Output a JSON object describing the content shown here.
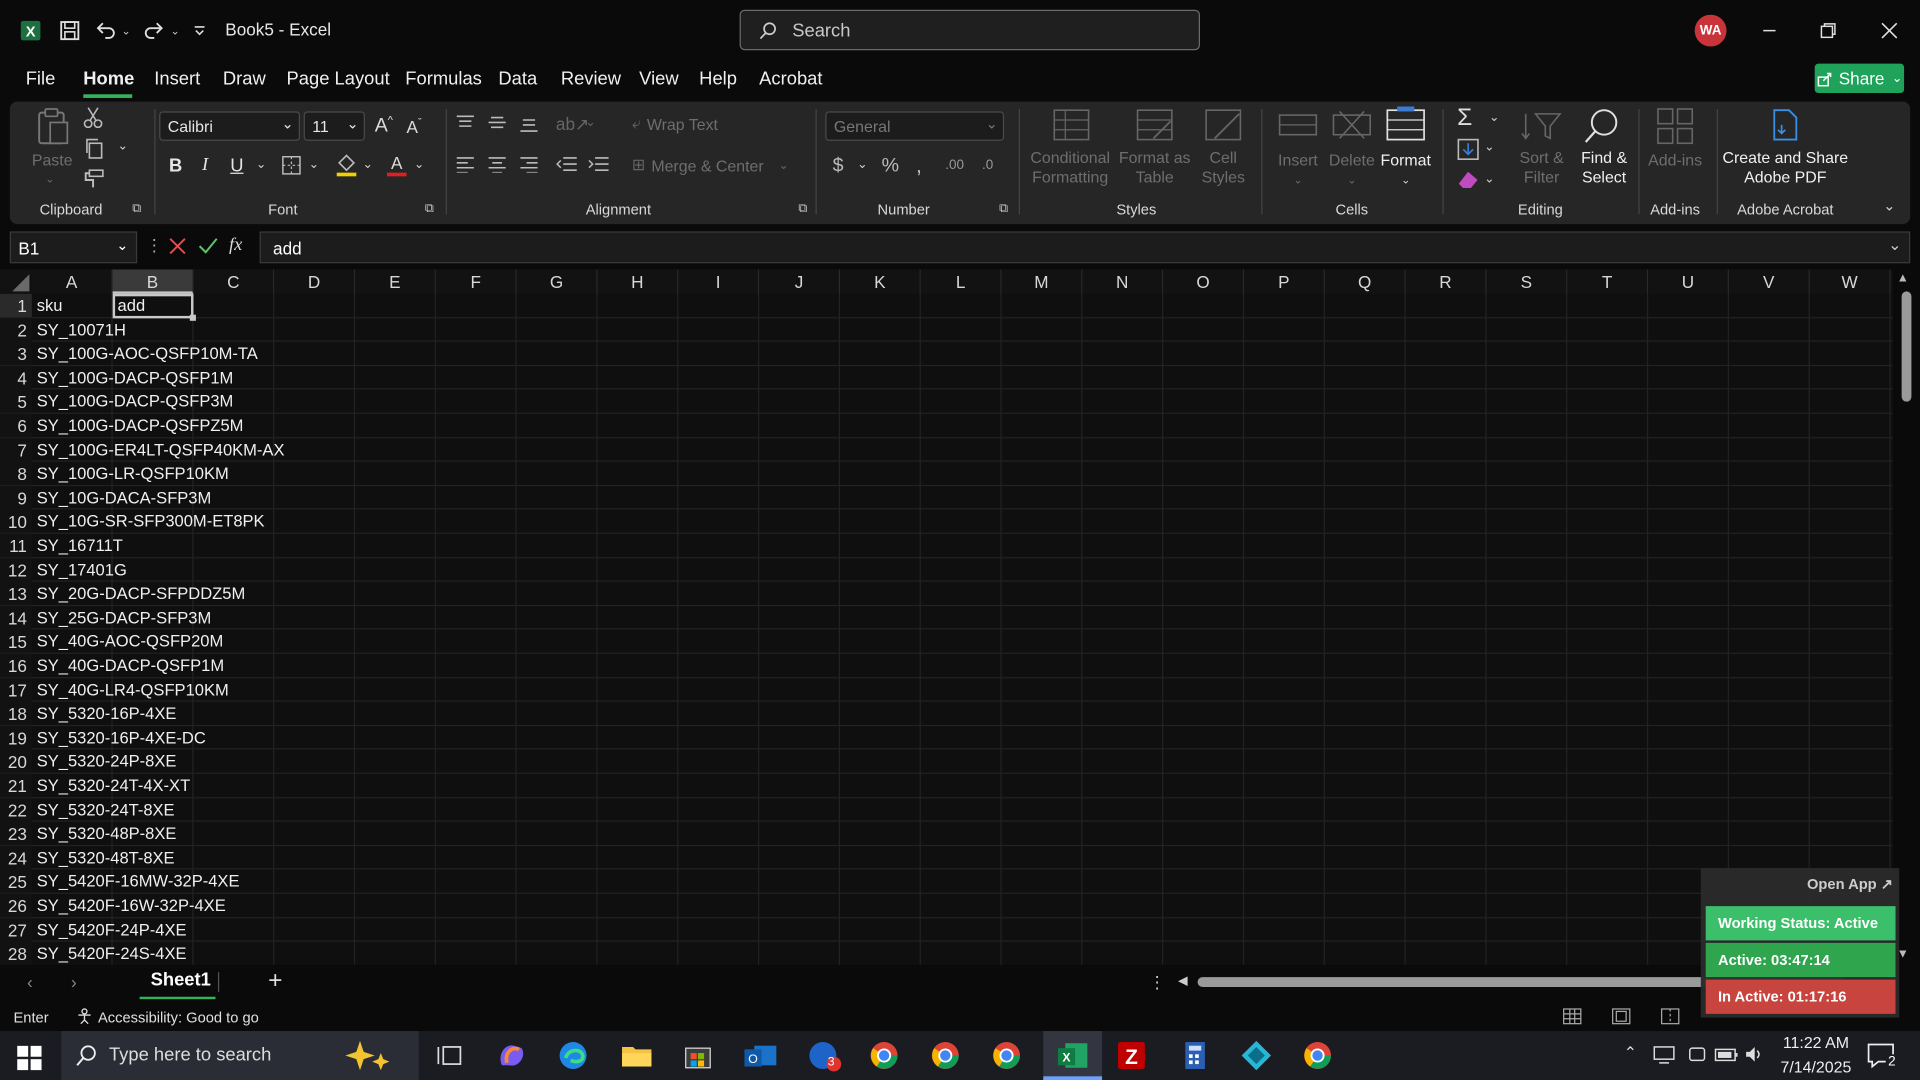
{
  "titlebar": {
    "title": "Book5  -  Excel",
    "search_placeholder": "Search",
    "avatar_initials": "WA"
  },
  "menu": [
    "File",
    "Home",
    "Insert",
    "Draw",
    "Page Layout",
    "Formulas",
    "Data",
    "Review",
    "View",
    "Help",
    "Acrobat"
  ],
  "share_label": "Share",
  "ribbon": {
    "font_name": "Calibri",
    "font_size": "11",
    "wrap_text": "Wrap Text",
    "merge_center": "Merge & Center",
    "number_format": "General",
    "paste": "Paste",
    "conditional_formatting": [
      "Conditional",
      "Formatting"
    ],
    "format_as_table": [
      "Format as",
      "Table"
    ],
    "cell_styles": [
      "Cell",
      "Styles"
    ],
    "insert": "Insert",
    "delete": "Delete",
    "format": "Format",
    "sort_filter": [
      "Sort &",
      "Filter"
    ],
    "find_select": [
      "Find &",
      "Select"
    ],
    "add_ins": "Add-ins",
    "create_share_pdf": [
      "Create and Share",
      "Adobe PDF"
    ],
    "groups": {
      "clipboard": "Clipboard",
      "font": "Font",
      "alignment": "Alignment",
      "number": "Number",
      "styles": "Styles",
      "cells": "Cells",
      "editing": "Editing",
      "addins": "Add-ins",
      "acrobat": "Adobe Acrobat"
    }
  },
  "formula_bar": {
    "name_box": "B1",
    "fx": "fx",
    "content": "add"
  },
  "columns": [
    "A",
    "B",
    "C",
    "D",
    "E",
    "F",
    "G",
    "H",
    "I",
    "J",
    "K",
    "L",
    "M",
    "N",
    "O",
    "P",
    "Q",
    "R",
    "S",
    "T",
    "U",
    "V",
    "W"
  ],
  "rows": [
    {
      "n": "1",
      "a": "sku",
      "b": "add"
    },
    {
      "n": "2",
      "a": "SY_10071H"
    },
    {
      "n": "3",
      "a": "SY_100G-AOC-QSFP10M-TA"
    },
    {
      "n": "4",
      "a": "SY_100G-DACP-QSFP1M"
    },
    {
      "n": "5",
      "a": "SY_100G-DACP-QSFP3M"
    },
    {
      "n": "6",
      "a": "SY_100G-DACP-QSFPZ5M"
    },
    {
      "n": "7",
      "a": "SY_100G-ER4LT-QSFP40KM-AX"
    },
    {
      "n": "8",
      "a": "SY_100G-LR-QSFP10KM"
    },
    {
      "n": "9",
      "a": "SY_10G-DACA-SFP3M"
    },
    {
      "n": "10",
      "a": "SY_10G-SR-SFP300M-ET8PK"
    },
    {
      "n": "11",
      "a": "SY_16711T"
    },
    {
      "n": "12",
      "a": "SY_17401G"
    },
    {
      "n": "13",
      "a": "SY_20G-DACP-SFPDDZ5M"
    },
    {
      "n": "14",
      "a": "SY_25G-DACP-SFP3M"
    },
    {
      "n": "15",
      "a": "SY_40G-AOC-QSFP20M"
    },
    {
      "n": "16",
      "a": "SY_40G-DACP-QSFP1M"
    },
    {
      "n": "17",
      "a": "SY_40G-LR4-QSFP10KM"
    },
    {
      "n": "18",
      "a": "SY_5320-16P-4XE"
    },
    {
      "n": "19",
      "a": "SY_5320-16P-4XE-DC"
    },
    {
      "n": "20",
      "a": "SY_5320-24P-8XE"
    },
    {
      "n": "21",
      "a": "SY_5320-24T-4X-XT"
    },
    {
      "n": "22",
      "a": "SY_5320-24T-8XE"
    },
    {
      "n": "23",
      "a": "SY_5320-48P-8XE"
    },
    {
      "n": "24",
      "a": "SY_5320-48T-8XE"
    },
    {
      "n": "25",
      "a": "SY_5420F-16MW-32P-4XE"
    },
    {
      "n": "26",
      "a": "SY_5420F-16W-32P-4XE"
    },
    {
      "n": "27",
      "a": "SY_5420F-24P-4XE"
    },
    {
      "n": "28",
      "a": "SY_5420F-24S-4XE"
    }
  ],
  "sheet_tab": "Sheet1",
  "status": {
    "mode": "Enter",
    "accessibility": "Accessibility: Good to go"
  },
  "taskbar": {
    "search_placeholder": "Type here to search",
    "time": "11:22 AM",
    "date": "7/14/2025",
    "notification_count": "2",
    "app_badge": "3"
  },
  "widget": {
    "open_app": "Open App ↗",
    "working_status": "Working Status: Active",
    "active": "Active: 03:47:14",
    "inactive": "In Active: 01:17:16"
  },
  "colors": {
    "accent_green": "#1fa35a",
    "excel_green": "#1d6f42",
    "selection": "#c9c9c9",
    "status_green": "#3cbf6a",
    "status_active": "#2fa64e",
    "status_inactive": "#c8443f"
  }
}
